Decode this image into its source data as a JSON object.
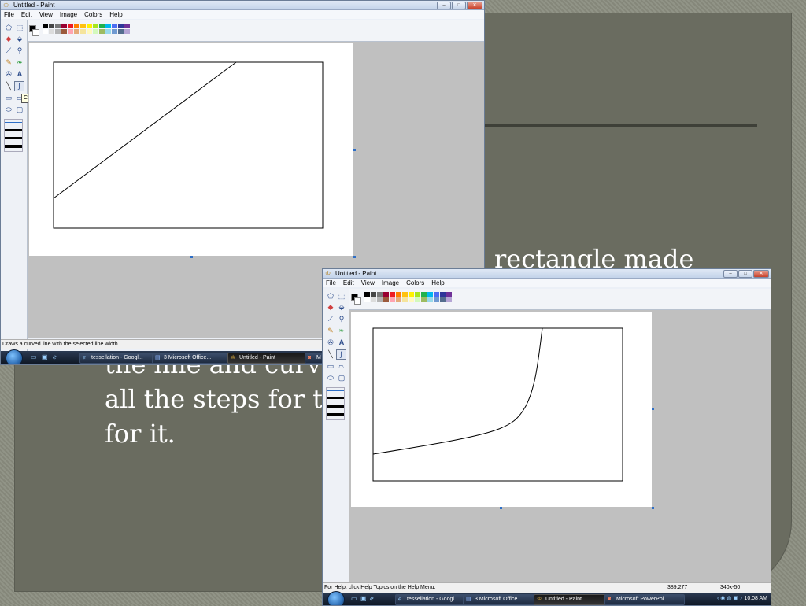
{
  "slide": {
    "line1": "rectangle made",
    "line2": "the line and curv",
    "line3": "all the steps for t",
    "line4": "for it."
  },
  "window1": {
    "title": "Untitled - Paint",
    "menu": [
      "File",
      "Edit",
      "View",
      "Image",
      "Colors",
      "Help"
    ],
    "tooltip": "Curve",
    "status": "Draws a curved line with the selected line width.",
    "taskbar": {
      "items": [
        "tessellation - Googl...",
        "3 Microsoft Office...",
        "Untitled - Paint",
        "M"
      ]
    }
  },
  "window2": {
    "title": "Untitled - Paint",
    "menu": [
      "File",
      "Edit",
      "View",
      "Image",
      "Colors",
      "Help"
    ],
    "status": "For Help, click Help Topics on the Help Menu.",
    "coords": "389,277",
    "size": "340x-50",
    "taskbar": {
      "items": [
        "tessellation - Googl...",
        "3 Microsoft Office...",
        "Untitled - Paint",
        "Microsoft PowerPoi..."
      ],
      "clock": "10:08 AM"
    }
  },
  "palette": {
    "top": [
      "#000000",
      "#464646",
      "#787878",
      "#990030",
      "#ed1c24",
      "#ff7e00",
      "#ffc20e",
      "#fff200",
      "#a8e61d",
      "#22b14c",
      "#00b7ef",
      "#4d6df3",
      "#2f3699",
      "#6f3198"
    ],
    "bottom": [
      "#ffffff",
      "#dcdcdc",
      "#b4b4b4",
      "#9c5a3c",
      "#ffa3b1",
      "#e5aa7a",
      "#f5e49c",
      "#fff9bd",
      "#d3f9bc",
      "#9dbb61",
      "#99d9ea",
      "#709ad1",
      "#546d8e",
      "#b5a5d5"
    ]
  },
  "window_buttons": {
    "minimize": "–",
    "maximize": "□",
    "close": "✕"
  },
  "icons": {
    "app": "paint-icon",
    "start": "windows-orb-icon",
    "tools": [
      "free-select-icon",
      "rect-select-icon",
      "eraser-icon",
      "fill-icon",
      "eyedropper-icon",
      "magnifier-icon",
      "pencil-icon",
      "brush-icon",
      "airbrush-icon",
      "text-icon",
      "line-icon",
      "curve-icon",
      "rectangle-icon",
      "polygon-icon",
      "ellipse-icon",
      "rounded-rect-icon"
    ]
  },
  "tool_glyphs": {
    "free_select": "⬠",
    "rect_select": "⬚",
    "eraser": "◆",
    "fill": "⬙",
    "eyedropper": "⟋",
    "magnifier": "⚲",
    "pencil": "✎",
    "brush": "❧",
    "airbrush": "✇",
    "text": "A",
    "line": "╲",
    "curve": "∫",
    "rectangle": "▭",
    "polygon": "⏢",
    "ellipse": "⬭",
    "rounded_rect": "▢"
  }
}
